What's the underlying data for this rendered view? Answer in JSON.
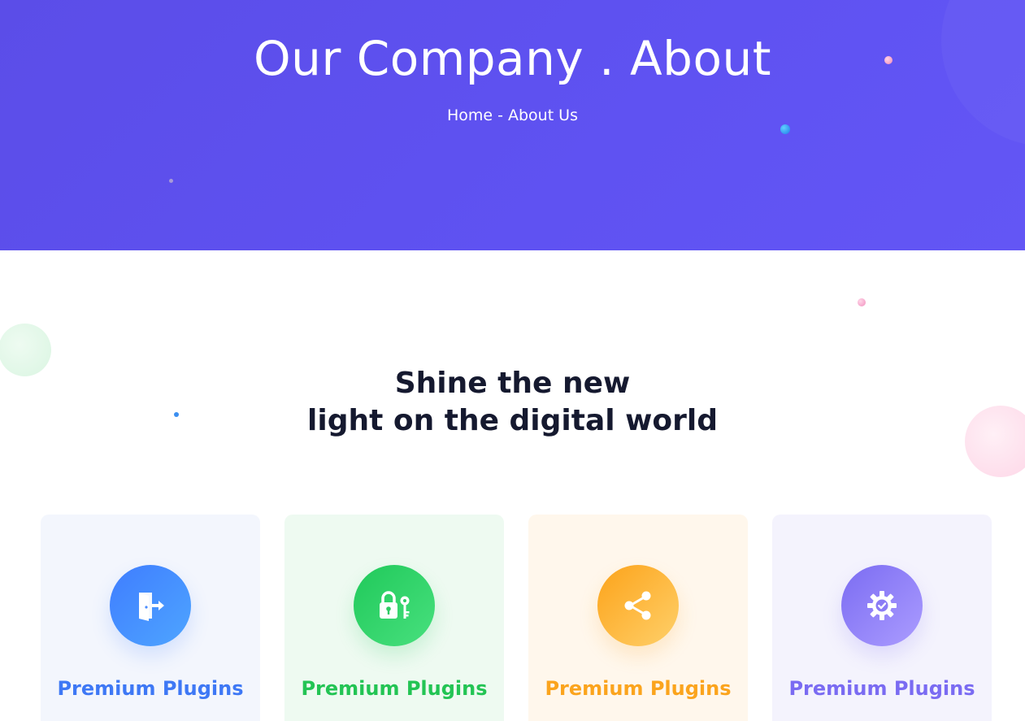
{
  "hero": {
    "title": "Our Company . About",
    "breadcrumb": {
      "home": "Home",
      "separator": "-",
      "current": "About Us"
    },
    "background_color": "#5f52f2"
  },
  "intro": {
    "title_line_1": "Shine the new",
    "title_line_2": "light on the digital world"
  },
  "features": [
    {
      "title": "Premium Plugins",
      "icon": "door-exit-icon",
      "color": "#3e78f5"
    },
    {
      "title": "Premium Plugins",
      "icon": "lock-key-icon",
      "color": "#23c454"
    },
    {
      "title": "Premium Plugins",
      "icon": "share-icon",
      "color": "#fba41d"
    },
    {
      "title": "Premium Plugins",
      "icon": "gear-check-icon",
      "color": "#7a6bf2"
    }
  ]
}
